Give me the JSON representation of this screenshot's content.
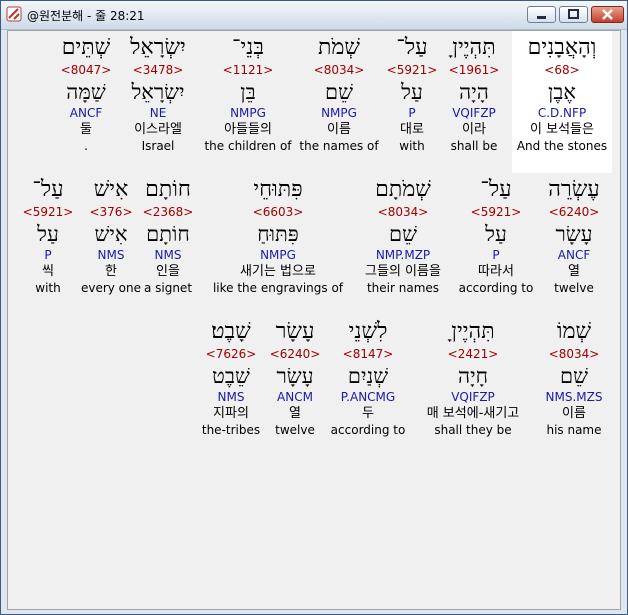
{
  "window": {
    "title": "@원전분해 - 줄 28:21"
  },
  "rows": [
    [
      {
        "heb": "וְהָאֲבָנִים",
        "strong": "<68>",
        "lex": "אֶבֶן",
        "parse": "C.D.NFP",
        "kor": "이 보석들은",
        "eng": "And the stones",
        "highlight": true
      },
      {
        "heb": "תִּהְיֶיןָ",
        "strong": "<1961>",
        "lex": "הָיָה",
        "parse": "VQIFZP",
        "kor": "이라",
        "eng": "shall be"
      },
      {
        "heb": "עַל־",
        "strong": "<5921>",
        "lex": "עַל",
        "parse": "P",
        "kor": "대로",
        "eng": "with"
      },
      {
        "heb": "שְׁמֹת",
        "strong": "<8034>",
        "lex": "שֵׁם",
        "parse": "NMPG",
        "kor": "이름",
        "eng": "the names of"
      },
      {
        "heb": "בְּנֵי־",
        "strong": "<1121>",
        "lex": "בֵּן",
        "parse": "NMPG",
        "kor": "아들들의",
        "eng": "the children of"
      },
      {
        "heb": "יִשְׂרָאֵל",
        "strong": "<3478>",
        "lex": "יִשְׂרָאֵל",
        "parse": "NE",
        "kor": "이스라엘",
        "eng": "Israel"
      },
      {
        "heb": "שְׁתֵּים",
        "strong": "<8047>",
        "lex": "שַׁמָּה",
        "parse": "ANCF",
        "kor": "둘",
        "eng": "."
      }
    ],
    [
      {
        "heb": "עֶשְׂרֵה",
        "strong": "<6240>",
        "lex": "עָשָׂר",
        "parse": "ANCF",
        "kor": "열",
        "eng": "twelve"
      },
      {
        "heb": "עַל־",
        "strong": "<5921>",
        "lex": "עַל",
        "parse": "P",
        "kor": "따라서",
        "eng": "according to"
      },
      {
        "heb": "שְׁמֹתָם",
        "strong": "<8034>",
        "lex": "שֵׁם",
        "parse": "NMP.MZP",
        "kor": "그들의 이름을",
        "eng": "their names"
      },
      {
        "heb": "פִּתּוּחֵי",
        "strong": "<6603>",
        "lex": "פִּתּוּחַ",
        "parse": "NMPG",
        "kor": "새기는 법으로",
        "eng": "like the engravings of"
      },
      {
        "heb": "חוֹתָם",
        "strong": "<2368>",
        "lex": "חוֹתָם",
        "parse": "NMS",
        "kor": "인을",
        "eng": "a signet"
      },
      {
        "heb": "אִישׁ",
        "strong": "<376>",
        "lex": "אִישׁ",
        "parse": "NMS",
        "kor": "한",
        "eng": "every one"
      },
      {
        "heb": "עַל־",
        "strong": "<5921>",
        "lex": "עַל",
        "parse": "P",
        "kor": "씩",
        "eng": "with"
      }
    ],
    [
      {
        "heb": "שְׁמוֹ",
        "strong": "<8034>",
        "lex": "שֵׁם",
        "parse": "NMS.MZS",
        "kor": "이름",
        "eng": "his name"
      },
      {
        "heb": "תִּהְיֶיןָ",
        "strong": "<2421>",
        "lex": "חָיָה",
        "parse": "VQIFZP",
        "kor": "매 보석에-새기고",
        "eng": "shall they be"
      },
      {
        "heb": "לִשְׁנֵי",
        "strong": "<8147>",
        "lex": "שְׁנַיִם",
        "parse": "P.ANCMG",
        "kor": "두",
        "eng": "according to"
      },
      {
        "heb": "עָשָׂר",
        "strong": "<6240>",
        "lex": "עָשָׂר",
        "parse": "ANCM",
        "kor": "열",
        "eng": "twelve"
      },
      {
        "heb": "שָׁבֶט׃",
        "strong": "<7626>",
        "lex": "שֵׁבֶט",
        "parse": "NMS",
        "kor": "지파의",
        "eng": "the-tribes"
      }
    ]
  ]
}
